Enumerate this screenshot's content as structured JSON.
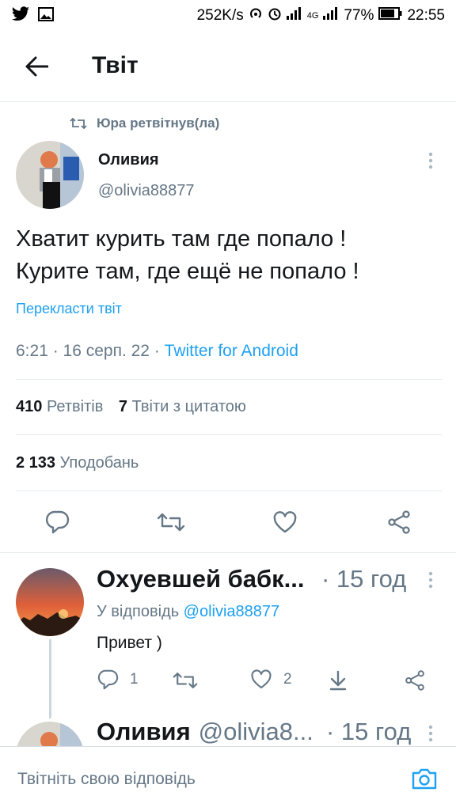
{
  "status_bar": {
    "speed": "252K/s",
    "network": "4G",
    "battery": "77%",
    "time": "22:55",
    "left_icons": [
      "twitter-bird-icon",
      "image-icon"
    ]
  },
  "header": {
    "title": "Твіт"
  },
  "tweet": {
    "retweeted_by": "Юра ретвітнув(ла)",
    "author_name": "Оливия",
    "author_handle": "@olivia88877",
    "text_line1": "Хватит курить там где попало !",
    "text_line2": "Курите там, где ещё не попало !",
    "translate": "Перекласти твіт",
    "time_date": "6:21 · 16 серп. 22 · ",
    "source": "Twitter for Android",
    "retweets_count": "410",
    "retweets_label": "Ретвітів",
    "quotes_count": "7",
    "quotes_label": "Твіти з цитатою",
    "likes_count": "2 133",
    "likes_label": "Уподобань"
  },
  "reply": {
    "author_name": "Охуевшей бабк...",
    "time": "· 15 год",
    "reply_to_prefix": "У відповідь ",
    "reply_to_handle": "@olivia88877",
    "text": "Привет )",
    "reply_count": "1",
    "like_count": "2"
  },
  "next_reply": {
    "author_name": "Оливия",
    "author_handle": "@olivia8...",
    "time": "· 15 год"
  },
  "compose": {
    "placeholder": "Твітніть свою відповідь"
  },
  "colors": {
    "accent": "#1da1f2",
    "muted": "#657786",
    "text": "#14171a"
  }
}
